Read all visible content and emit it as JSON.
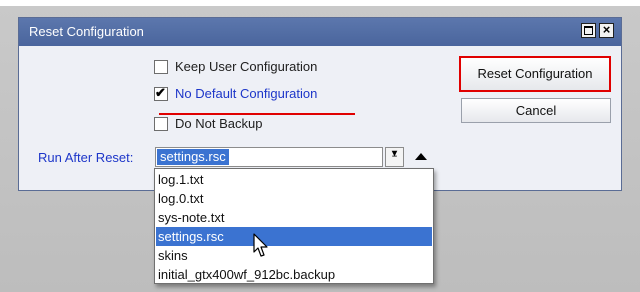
{
  "dialog": {
    "title": "Reset Configuration",
    "title_buttons": {
      "maximize_icon": "maximize-icon",
      "close_glyph": "×"
    }
  },
  "options": [
    {
      "label": "Keep User Configuration",
      "checked": false
    },
    {
      "label": "No Default Configuration",
      "checked": true
    },
    {
      "label": "Do Not Backup",
      "checked": false
    }
  ],
  "buttons": {
    "reset_label": "Reset Configuration",
    "cancel_label": "Cancel"
  },
  "run_after_reset": {
    "label": "Run After Reset:",
    "value": "settings.rsc"
  },
  "dropdown": {
    "items": [
      "log.1.txt",
      "log.0.txt",
      "sys-note.txt",
      "settings.rsc",
      "skins",
      "initial_gtx400wf_912bc.backup"
    ],
    "selected": "settings.rsc"
  },
  "colors": {
    "titlebar": "#4f6aa2",
    "accent_blue": "#1d36c9",
    "highlight": "#e00000",
    "selection": "#3b73d1"
  }
}
